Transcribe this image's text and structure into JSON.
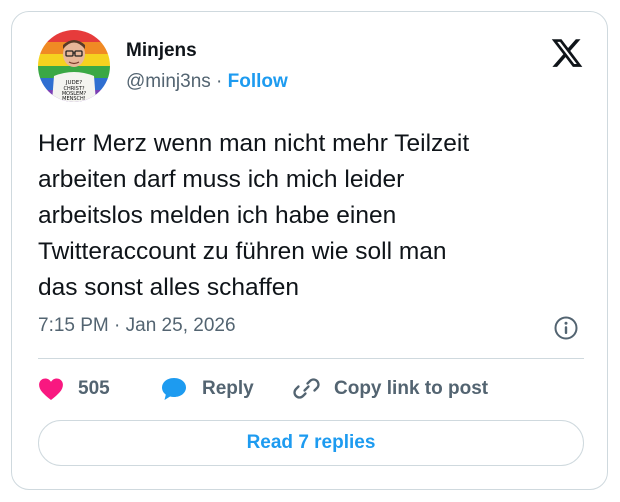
{
  "author": {
    "name": "Minjens",
    "handle": "@minj3ns",
    "separator": " · ",
    "follow_label": "Follow",
    "avatar_shirt_text": "JUDE? CHRIST? MOSLEM? MENSCH!"
  },
  "tweet": {
    "text": "Herr Merz wenn man nicht mehr Teilzeit\narbeiten darf muss ich mich leider\narbeitslos melden ich habe einen\nTwitteraccount zu führen wie soll man\ndas sonst alles schaffen",
    "timestamp": "7:15 PM · Jan 25, 2026"
  },
  "actions": {
    "like_count": "505",
    "reply_label": "Reply",
    "copy_label": "Copy link to post"
  },
  "footer": {
    "read_replies_label": "Read 7 replies"
  },
  "icons": {
    "brand": "x-logo-icon",
    "info": "info-icon",
    "like": "heart-icon",
    "reply": "speech-bubble-icon",
    "copy": "link-icon"
  },
  "colors": {
    "accent": "#1d9bf0",
    "like": "#f91880",
    "text_primary": "#0f1419",
    "text_secondary": "#536471",
    "border": "#cfd9de"
  }
}
